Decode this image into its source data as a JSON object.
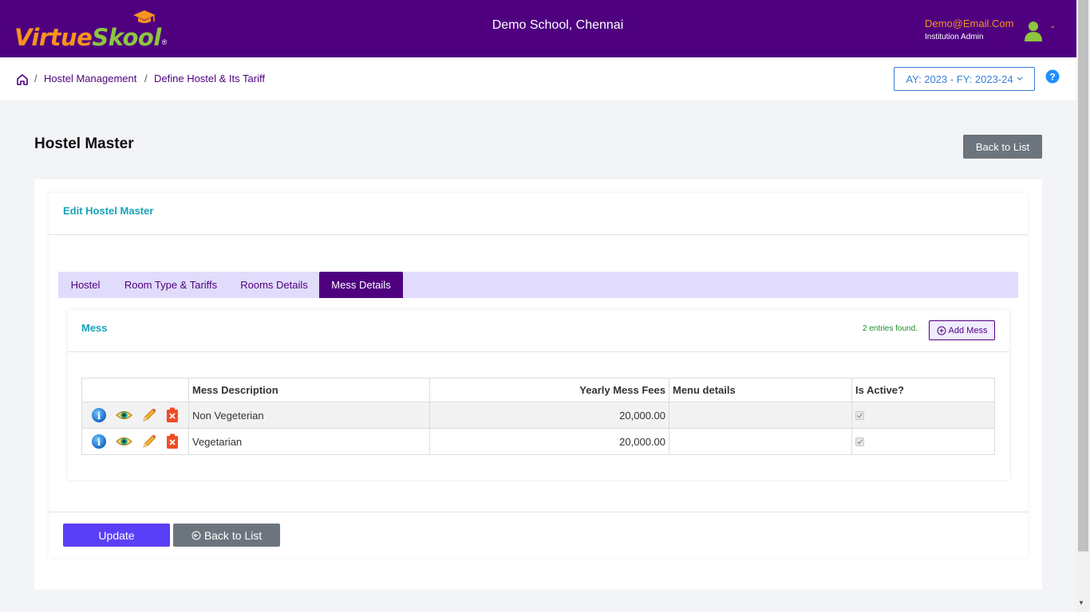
{
  "header": {
    "logo": {
      "part1": "Virtue",
      "part2": "Skool",
      "reg": "®"
    },
    "school_name": "Demo School, Chennai",
    "user_email": "Demo@Email.Com",
    "user_role": "Institution Admin"
  },
  "breadcrumb": {
    "items": [
      "Hostel Management",
      "Define Hostel & Its Tariff"
    ],
    "separator": "/"
  },
  "academic_year": {
    "selected": "AY: 2023 - FY: 2023-24"
  },
  "page": {
    "title": "Hostel Master",
    "back_to_list_label": "Back to List",
    "card_title": "Edit Hostel Master"
  },
  "tabs": [
    {
      "label": "Hostel",
      "active": false
    },
    {
      "label": "Room Type & Tariffs",
      "active": false
    },
    {
      "label": "Rooms Details",
      "active": false
    },
    {
      "label": "Mess Details",
      "active": true
    }
  ],
  "mess": {
    "title": "Mess",
    "entries_text": "2 entries found.",
    "add_label": "Add Mess",
    "columns": [
      "",
      "Mess Description",
      "Yearly Mess Fees",
      "Menu details",
      "Is Active?"
    ],
    "rows": [
      {
        "description": "Non Vegeterian",
        "fees": "20,000.00",
        "menu": "",
        "active": true
      },
      {
        "description": "Vegetarian",
        "fees": "20,000.00",
        "menu": "",
        "active": true
      }
    ]
  },
  "footer": {
    "update_label": "Update",
    "back_label": "Back to List"
  },
  "colors": {
    "primary": "#4e007f",
    "accent_orange": "#f7931e",
    "accent_green": "#8dc63f",
    "teal": "#17a2b8",
    "update_button": "#5a3ff6",
    "secondary_button": "#6c757d"
  },
  "icons": {
    "logo_cap": "graduation-cap-icon",
    "user": "user-avatar-icon",
    "home": "home-icon",
    "help": "help-icon",
    "row_actions": [
      "info-icon",
      "view-eye-icon",
      "edit-pencil-icon",
      "delete-icon"
    ],
    "add": "plus-circle-icon",
    "back": "arrow-left-circle-icon"
  }
}
